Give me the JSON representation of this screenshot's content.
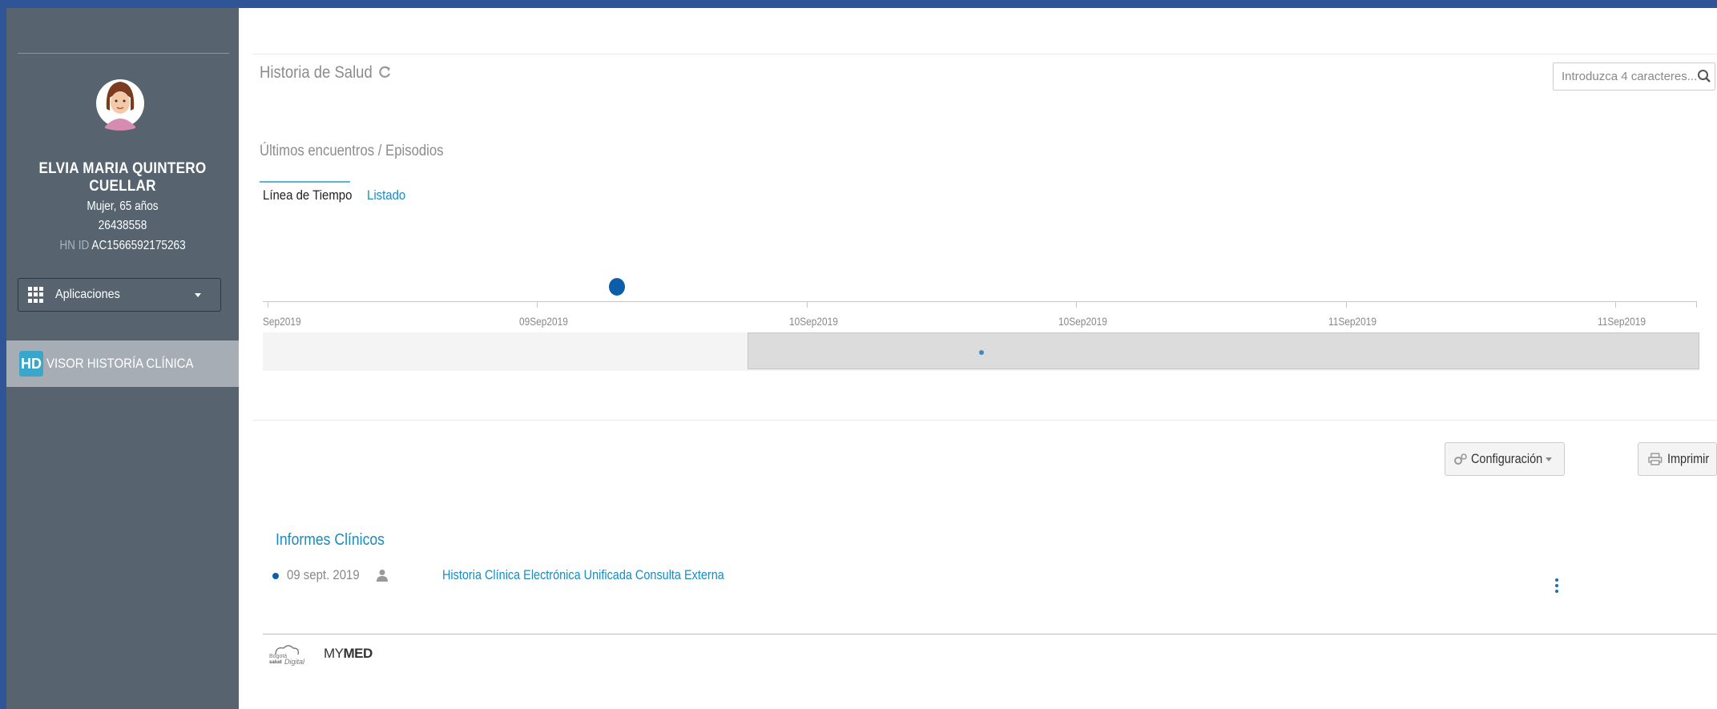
{
  "patient": {
    "name": "ELVIA MARIA QUINTERO CUELLAR",
    "gender_age": "Mujer, 65 años",
    "document": "26438558",
    "hn_prefix": "HN ID",
    "hn_id": "AC1566592175263"
  },
  "sidebar": {
    "apps_label": "Aplicaciones",
    "nav": [
      {
        "badge": "HD",
        "label": "VISOR HISTORÍA CLÍNICA",
        "active": true
      }
    ]
  },
  "header": {
    "title": "Historia de Salud",
    "search_placeholder": "Introduzca 4 caracteres..."
  },
  "encounters": {
    "subtitle": "Últimos encuentros / Episodios",
    "tabs": [
      {
        "label": "Línea de Tiempo",
        "active": true
      },
      {
        "label": "Listado",
        "active": false
      }
    ],
    "timeline_labels": [
      "Sep2019",
      "09Sep2019",
      "10Sep2019",
      "10Sep2019",
      "11Sep2019",
      "11Sep2019"
    ]
  },
  "toolbar": {
    "config_label": "Configuración",
    "print_label": "Imprimir"
  },
  "reports": {
    "title": "Informes Clínicos",
    "items": [
      {
        "date": "09 sept. 2019",
        "title": "Historia Clínica Electrónica Unificada Consulta Externa"
      }
    ]
  },
  "footer": {
    "logo_bogota": "Bogotá salud digital",
    "logo_mymed_a": "MY",
    "logo_mymed_b": "MED"
  },
  "colors": {
    "frame": "#2f5597",
    "sidebar": "#57636f",
    "accent": "#1a8bbf",
    "event": "#0d5ea8"
  }
}
